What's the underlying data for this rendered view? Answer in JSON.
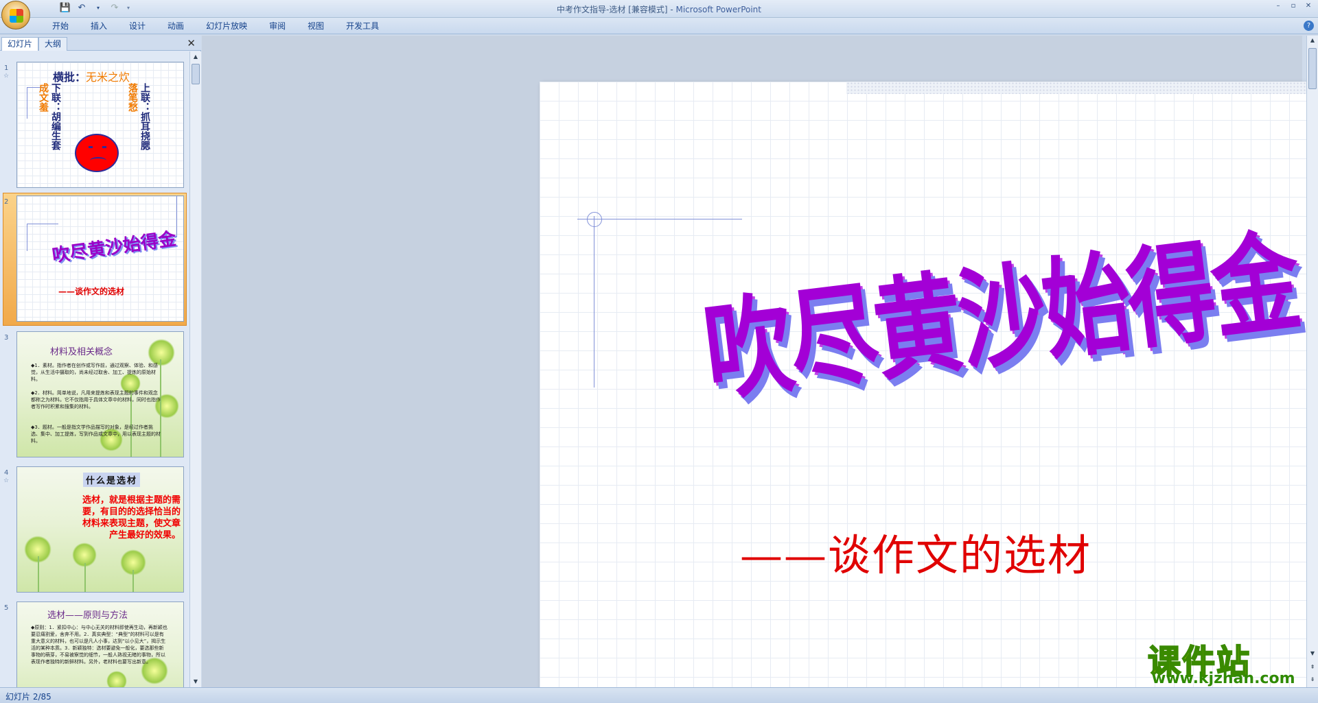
{
  "window": {
    "title": "中考作文指导-选材 [兼容模式] - ",
    "app_name": "Microsoft PowerPoint"
  },
  "qat": {
    "save_icon": "save-icon",
    "undo_icon": "undo-icon",
    "redo_icon": "redo-icon"
  },
  "ribbon": {
    "tabs": [
      "开始",
      "插入",
      "设计",
      "动画",
      "幻灯片放映",
      "审阅",
      "视图",
      "开发工具"
    ]
  },
  "panel": {
    "tab_slides": "幻灯片",
    "tab_outline": "大纲",
    "close": "✕"
  },
  "thumbs": [
    {
      "num": "1",
      "title": "横批：",
      "title_hl": "无米之炊",
      "col1": "下联：胡编生套",
      "col1b": "成文羞",
      "col2": "落笔愁",
      "col2b": "上联：抓耳挠腮"
    },
    {
      "num": "2",
      "title": "吹尽黄沙始得金",
      "subtitle": "——谈作文的选材"
    },
    {
      "num": "3",
      "title": "材料及相关概念",
      "body1": "◆1．素材。指作者在创作或写作前，通过观察、体验、和感觉，从生活中摄取的，尚未经过取舍、加工、提炼的原始材料。",
      "body2": "◆2．材料。简单地说，凡用来提炼和表现主题的事件和观念都称之为材料。它不仅指用于具体文章中的材料，同时也指作者写作时积累和搜集的材料。",
      "body3": "◆3．题材。一般是指文学作品描写的对象，是经过作者挑选、集中、加工提炼，写到作品或文章中，用以表现主题的材料。"
    },
    {
      "num": "4",
      "title": "什么是选材",
      "body": "选材，就是根据主题的需要，有目的的选择恰当的材料来表现主题，使文章产生最好的效果。"
    },
    {
      "num": "5",
      "title": "选材——原则与方法",
      "body": "◆原则：1．紧扣中心：与中心无关的材料即使再生动，再新颖也要忍痛割爱，舍弃不用。2．真实典型：“典型”的材料可以是有重大意义的材料，也可以是凡人小事，达到“以小见大”，揭示生活的某种本质。3．新颖独特：选材要避免一般化，要选那些新事物的萌芽，不易被察觉的细节，一般人熟视无睹的事物，所以表现作者独特的新鲜材料。另外，老材料也要写出新意。"
    }
  ],
  "slide": {
    "title": "吹尽黄沙始得金",
    "subtitle": "——谈作文的选材"
  },
  "status": {
    "text": "幻灯片 2/85"
  },
  "watermark": {
    "text": "课件站",
    "url": "www.kjzhan.com"
  },
  "colors": {
    "title_purple": "#a300d6",
    "subtitle_red": "#e00000",
    "accent_orange": "#f07a00"
  }
}
